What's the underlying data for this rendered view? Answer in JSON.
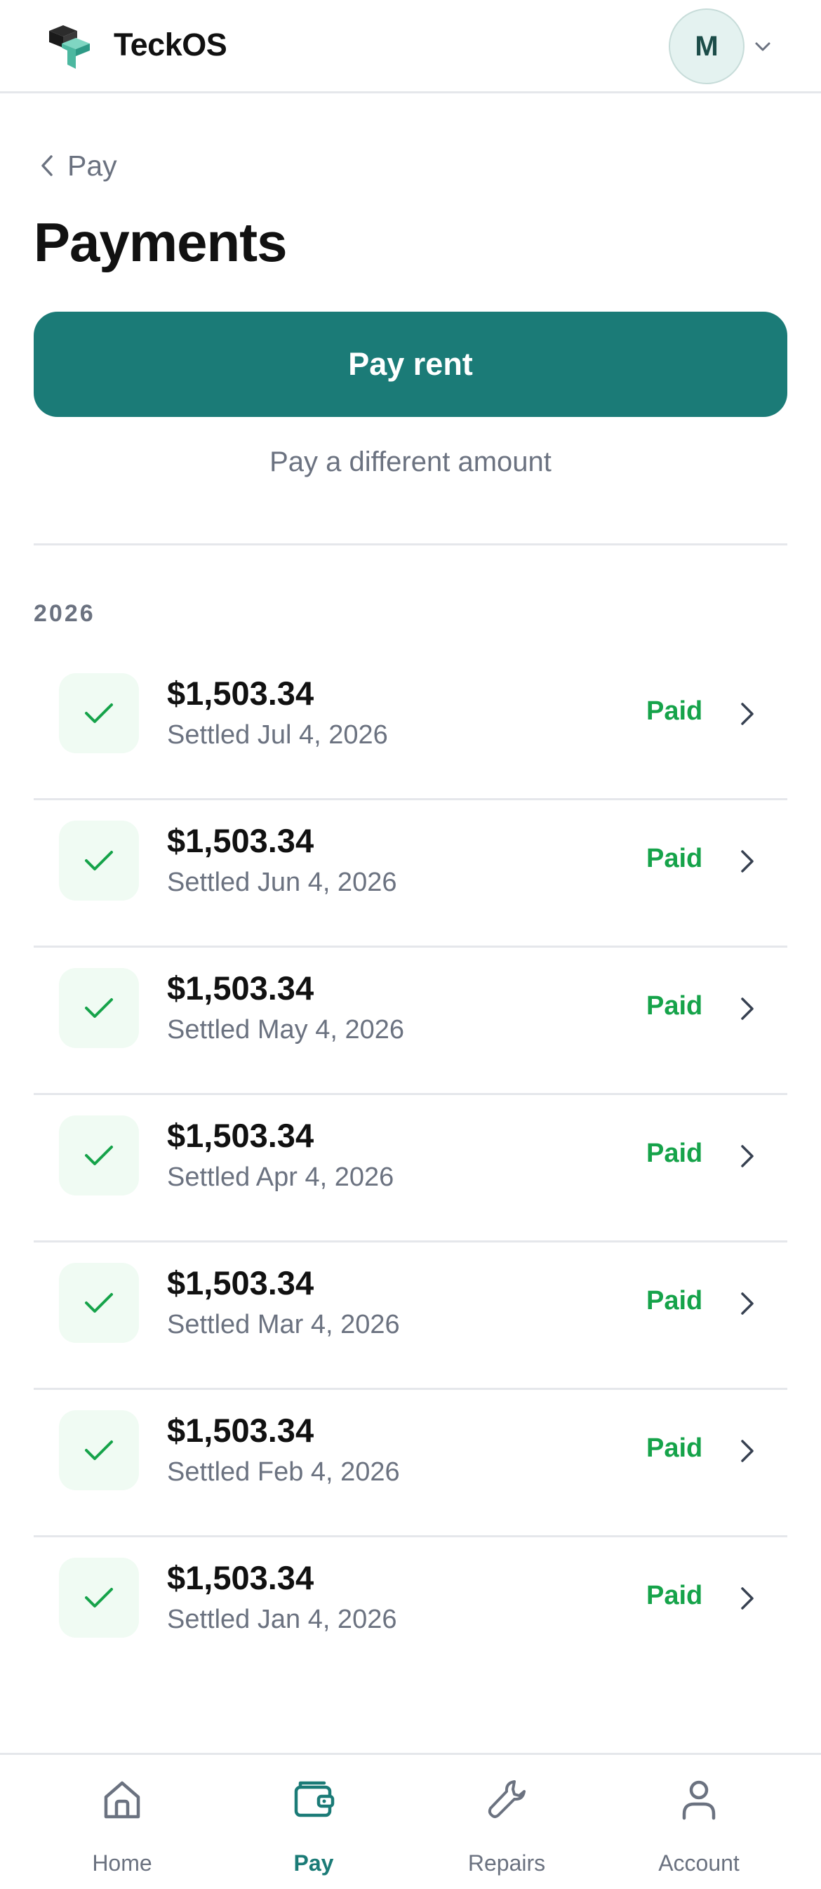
{
  "header": {
    "brand": "TeckOS",
    "avatar_initial": "M"
  },
  "breadcrumb": {
    "label": "Pay"
  },
  "page": {
    "title": "Payments"
  },
  "actions": {
    "pay_rent_label": "Pay rent",
    "different_amount_label": "Pay a different amount"
  },
  "section": {
    "year": "2026"
  },
  "payments": [
    {
      "amount": "$1,503.34",
      "settled": "Settled Jul 4, 2026",
      "status": "Paid"
    },
    {
      "amount": "$1,503.34",
      "settled": "Settled Jun 4, 2026",
      "status": "Paid"
    },
    {
      "amount": "$1,503.34",
      "settled": "Settled May 4, 2026",
      "status": "Paid"
    },
    {
      "amount": "$1,503.34",
      "settled": "Settled Apr 4, 2026",
      "status": "Paid"
    },
    {
      "amount": "$1,503.34",
      "settled": "Settled Mar 4, 2026",
      "status": "Paid"
    },
    {
      "amount": "$1,503.34",
      "settled": "Settled Feb 4, 2026",
      "status": "Paid"
    },
    {
      "amount": "$1,503.34",
      "settled": "Settled Jan 4, 2026",
      "status": "Paid"
    }
  ],
  "nav": {
    "items": [
      {
        "label": "Home",
        "icon": "home-icon"
      },
      {
        "label": "Pay",
        "icon": "wallet-icon",
        "active": true
      },
      {
        "label": "Repairs",
        "icon": "wrench-icon"
      },
      {
        "label": "Account",
        "icon": "user-icon"
      }
    ]
  },
  "colors": {
    "primary": "#1b7b77",
    "paid": "#16a34a",
    "muted": "#6b7280"
  }
}
